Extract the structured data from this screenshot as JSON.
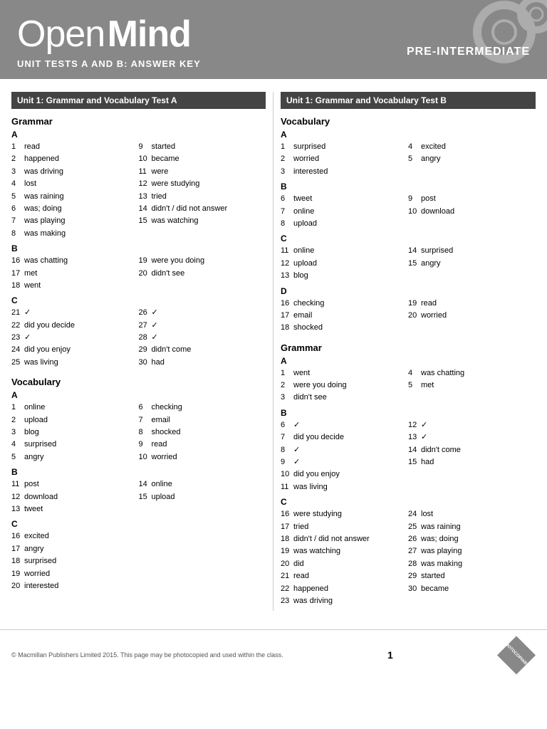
{
  "header": {
    "logo_open": "Open",
    "logo_mind": "Mind",
    "subtitle": "UNIT TESTS A AND B: ANSWER KEY",
    "level": "PRE-INTERMEDIATE"
  },
  "left_section": {
    "title": "Unit 1: Grammar and Vocabulary Test A",
    "grammar": {
      "heading": "Grammar",
      "sectionA": {
        "label": "A",
        "col1": [
          {
            "num": "1",
            "ans": "read"
          },
          {
            "num": "2",
            "ans": "happened"
          },
          {
            "num": "3",
            "ans": "was driving"
          },
          {
            "num": "4",
            "ans": "lost"
          },
          {
            "num": "5",
            "ans": "was raining"
          },
          {
            "num": "6",
            "ans": "was; doing"
          },
          {
            "num": "7",
            "ans": "was playing"
          },
          {
            "num": "8",
            "ans": "was making"
          }
        ],
        "col2": [
          {
            "num": "9",
            "ans": "started"
          },
          {
            "num": "10",
            "ans": "became"
          },
          {
            "num": "11",
            "ans": "were"
          },
          {
            "num": "12",
            "ans": "were studying"
          },
          {
            "num": "13",
            "ans": "tried"
          },
          {
            "num": "14",
            "ans": "didn't / did not answer"
          },
          {
            "num": "15",
            "ans": "was watching"
          }
        ]
      },
      "sectionB": {
        "label": "B",
        "col1": [
          {
            "num": "16",
            "ans": "was chatting"
          },
          {
            "num": "17",
            "ans": "met"
          },
          {
            "num": "18",
            "ans": "went"
          }
        ],
        "col2": [
          {
            "num": "19",
            "ans": "were you doing"
          },
          {
            "num": "20",
            "ans": "didn't see"
          }
        ]
      },
      "sectionC": {
        "label": "C",
        "col1": [
          {
            "num": "21",
            "ans": "✓"
          },
          {
            "num": "22",
            "ans": "did you decide"
          },
          {
            "num": "23",
            "ans": "✓"
          },
          {
            "num": "24",
            "ans": "did you enjoy"
          },
          {
            "num": "25",
            "ans": "was living"
          }
        ],
        "col2": [
          {
            "num": "26",
            "ans": "✓"
          },
          {
            "num": "27",
            "ans": "✓"
          },
          {
            "num": "28",
            "ans": "✓"
          },
          {
            "num": "29",
            "ans": "didn't come"
          },
          {
            "num": "30",
            "ans": "had"
          }
        ]
      }
    },
    "vocabulary": {
      "heading": "Vocabulary",
      "sectionA": {
        "label": "A",
        "col1": [
          {
            "num": "1",
            "ans": "online"
          },
          {
            "num": "2",
            "ans": "upload"
          },
          {
            "num": "3",
            "ans": "blog"
          },
          {
            "num": "4",
            "ans": "surprised"
          },
          {
            "num": "5",
            "ans": "angry"
          }
        ],
        "col2": [
          {
            "num": "6",
            "ans": "checking"
          },
          {
            "num": "7",
            "ans": "email"
          },
          {
            "num": "8",
            "ans": "shocked"
          },
          {
            "num": "9",
            "ans": "read"
          },
          {
            "num": "10",
            "ans": "worried"
          }
        ]
      },
      "sectionB": {
        "label": "B",
        "col1": [
          {
            "num": "11",
            "ans": "post"
          },
          {
            "num": "12",
            "ans": "download"
          },
          {
            "num": "13",
            "ans": "tweet"
          }
        ],
        "col2": [
          {
            "num": "14",
            "ans": "online"
          },
          {
            "num": "15",
            "ans": "upload"
          }
        ]
      },
      "sectionC": {
        "label": "C",
        "col1": [
          {
            "num": "16",
            "ans": "excited"
          },
          {
            "num": "17",
            "ans": "angry"
          },
          {
            "num": "18",
            "ans": "surprised"
          },
          {
            "num": "19",
            "ans": "worried"
          },
          {
            "num": "20",
            "ans": "interested"
          }
        ]
      }
    }
  },
  "right_section": {
    "title_top": "Unit 1: Grammar and Vocabulary Test B",
    "vocabulary": {
      "heading": "Vocabulary",
      "sectionA": {
        "label": "A",
        "col1": [
          {
            "num": "1",
            "ans": "surprised"
          },
          {
            "num": "2",
            "ans": "worried"
          },
          {
            "num": "3",
            "ans": "interested"
          }
        ],
        "col2": [
          {
            "num": "4",
            "ans": "excited"
          },
          {
            "num": "5",
            "ans": "angry"
          }
        ]
      },
      "sectionB": {
        "label": "B",
        "col1": [
          {
            "num": "6",
            "ans": "tweet"
          },
          {
            "num": "7",
            "ans": "online"
          },
          {
            "num": "8",
            "ans": "upload"
          }
        ],
        "col2": [
          {
            "num": "9",
            "ans": "post"
          },
          {
            "num": "10",
            "ans": "download"
          }
        ]
      },
      "sectionC": {
        "label": "C",
        "col1": [
          {
            "num": "11",
            "ans": "online"
          },
          {
            "num": "12",
            "ans": "upload"
          },
          {
            "num": "13",
            "ans": "blog"
          }
        ],
        "col2": [
          {
            "num": "14",
            "ans": "surprised"
          },
          {
            "num": "15",
            "ans": "angry"
          }
        ]
      },
      "sectionD": {
        "label": "D",
        "col1": [
          {
            "num": "16",
            "ans": "checking"
          },
          {
            "num": "17",
            "ans": "email"
          },
          {
            "num": "18",
            "ans": "shocked"
          }
        ],
        "col2": [
          {
            "num": "19",
            "ans": "read"
          },
          {
            "num": "20",
            "ans": "worried"
          }
        ]
      }
    },
    "grammar": {
      "heading": "Grammar",
      "sectionA": {
        "label": "A",
        "col1": [
          {
            "num": "1",
            "ans": "went"
          },
          {
            "num": "2",
            "ans": "were you doing"
          },
          {
            "num": "3",
            "ans": "didn't see"
          }
        ],
        "col2": [
          {
            "num": "4",
            "ans": "was chatting"
          },
          {
            "num": "5",
            "ans": "met"
          }
        ]
      },
      "sectionB": {
        "label": "B",
        "col1": [
          {
            "num": "6",
            "ans": "✓"
          },
          {
            "num": "7",
            "ans": "did you decide"
          },
          {
            "num": "8",
            "ans": "✓"
          },
          {
            "num": "9",
            "ans": "✓"
          },
          {
            "num": "10",
            "ans": "did you enjoy"
          },
          {
            "num": "11",
            "ans": "was living"
          }
        ],
        "col2": [
          {
            "num": "12",
            "ans": "✓"
          },
          {
            "num": "13",
            "ans": "✓"
          },
          {
            "num": "14",
            "ans": "didn't come"
          },
          {
            "num": "15",
            "ans": "had"
          }
        ]
      },
      "sectionC": {
        "label": "C",
        "col1": [
          {
            "num": "16",
            "ans": "were studying"
          },
          {
            "num": "17",
            "ans": "tried"
          },
          {
            "num": "18",
            "ans": "didn't / did not answer"
          },
          {
            "num": "19",
            "ans": "was watching"
          },
          {
            "num": "20",
            "ans": "did"
          },
          {
            "num": "21",
            "ans": "read"
          },
          {
            "num": "22",
            "ans": "happened"
          },
          {
            "num": "23",
            "ans": "was driving"
          }
        ],
        "col2": [
          {
            "num": "24",
            "ans": "lost"
          },
          {
            "num": "25",
            "ans": "was raining"
          },
          {
            "num": "26",
            "ans": "was; doing"
          },
          {
            "num": "27",
            "ans": "was playing"
          },
          {
            "num": "28",
            "ans": "was making"
          },
          {
            "num": "29",
            "ans": "started"
          },
          {
            "num": "30",
            "ans": "became"
          }
        ]
      }
    }
  },
  "footer": {
    "copyright": "© Macmillan Publishers Limited 2015. This page may be photocopied and used within the class.",
    "page_num": "1",
    "badge_text": "PHOTOCOPIABLE"
  }
}
